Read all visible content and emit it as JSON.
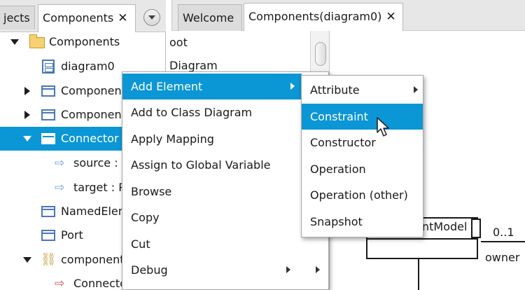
{
  "left_tabs": {
    "tab1_label": "jects",
    "tab2_label": "Components",
    "close_glyph": "✕"
  },
  "tree": {
    "items": [
      {
        "label": "Components",
        "icon": "folder-icon"
      },
      {
        "label": "diagram0",
        "icon": "diagram-icon"
      },
      {
        "label": "Componen",
        "icon": "class-icon"
      },
      {
        "label": "Componen",
        "icon": "class-icon"
      },
      {
        "label": "Connector",
        "icon": "class-icon",
        "selected": true
      },
      {
        "label": "source : l",
        "icon": "port-arrow-icon"
      },
      {
        "label": "target : P",
        "icon": "port-arrow-icon"
      },
      {
        "label": "NamedElen",
        "icon": "class-icon"
      },
      {
        "label": "Port",
        "icon": "class-icon"
      },
      {
        "label": "component",
        "icon": "association-icon"
      },
      {
        "label": "Connecto",
        "icon": "port-arrow-red-icon"
      }
    ]
  },
  "right_tabs": {
    "tab1_label": "Welcome",
    "tab2_label": "Components(diagram0)",
    "close_glyph": "✕"
  },
  "middle": {
    "line1": "oot",
    "line2": "Diagram"
  },
  "canvas": {
    "class_label": "ntModel",
    "multiplicity": "0..1",
    "role": "owner"
  },
  "context_menu": {
    "items": [
      {
        "label": "Add Element",
        "submenu": true,
        "highlight": true
      },
      {
        "label": "Add to Class Diagram"
      },
      {
        "label": "Apply Mapping"
      },
      {
        "label": "Assign to Global Variable"
      },
      {
        "label": "Browse"
      },
      {
        "label": "Copy"
      },
      {
        "label": "Cut"
      },
      {
        "label": "Debug",
        "submenu": true
      }
    ]
  },
  "submenu": {
    "items": [
      {
        "label": "Attribute",
        "submenu": true
      },
      {
        "label": "Constraint",
        "highlight": true
      },
      {
        "label": "Constructor"
      },
      {
        "label": "Operation"
      },
      {
        "label": "Operation (other)"
      },
      {
        "label": "Snapshot"
      }
    ]
  },
  "colors": {
    "selection": "#0b96d6",
    "class_icon": "#4a78b8",
    "folder": "#f7d171"
  }
}
